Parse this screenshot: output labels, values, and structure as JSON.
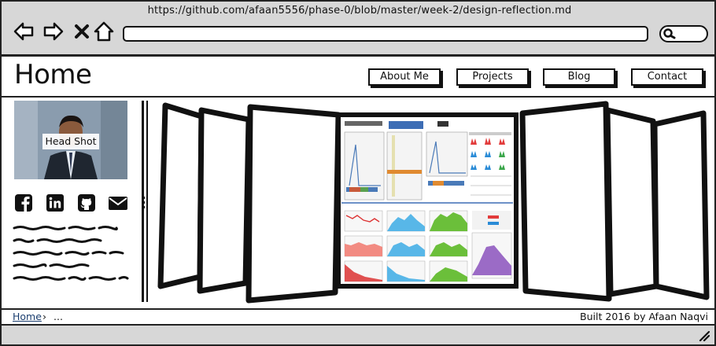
{
  "browser": {
    "url": "https://github.com/afaan5556/phase-0/blob/master/week-2/design-reflection.md",
    "icons": [
      "back-arrow-icon",
      "forward-arrow-icon",
      "close-icon",
      "home-icon",
      "search-icon"
    ]
  },
  "header": {
    "title": "Home",
    "nav": [
      "About Me",
      "Projects",
      "Blog",
      "Contact"
    ]
  },
  "sidebar": {
    "headshot_label": "Head Shot",
    "social_icons": [
      "facebook-icon",
      "linkedin-icon",
      "github-icon",
      "email-icon"
    ]
  },
  "footer": {
    "breadcrumb_home": "Home",
    "breadcrumb_sep": "›",
    "breadcrumb_rest": "...",
    "credit": "Built 2016 by Afaan Naqvi"
  },
  "colors": {
    "chrome": "#d7d7d7",
    "link": "#1a3d6e"
  }
}
